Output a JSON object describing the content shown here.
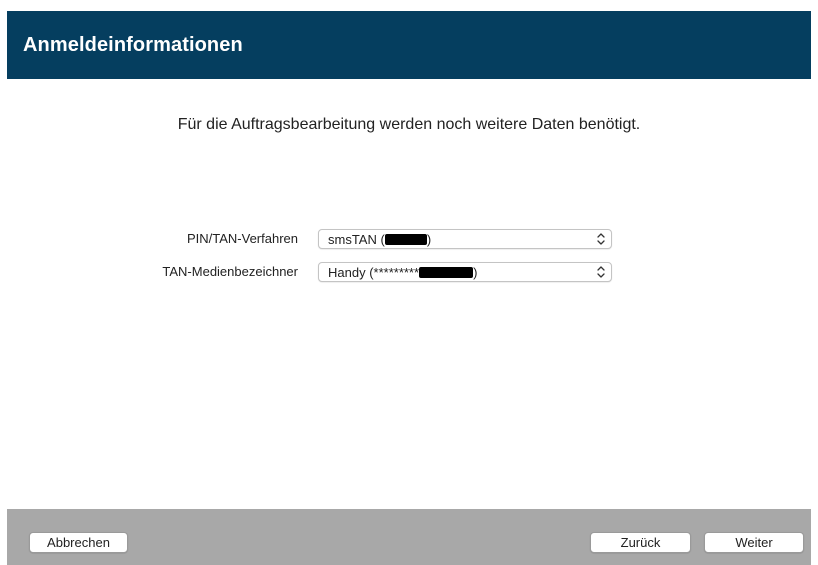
{
  "header": {
    "title": "Anmeldeinformationen"
  },
  "intro": {
    "text": "Für die Auftragsbearbeitung werden noch weitere Daten benötigt."
  },
  "form": {
    "pin_tan": {
      "label": "PIN/TAN-Verfahren",
      "value_prefix": "smsTAN (",
      "value_suffix": ")"
    },
    "tan_medium": {
      "label": "TAN-Medienbezeichner",
      "value_prefix": "Handy (*********",
      "value_suffix": ")"
    }
  },
  "footer": {
    "cancel_label": "Abbrechen",
    "back_label": "Zurück",
    "next_label": "Weiter"
  },
  "colors": {
    "header_bg": "#053e5f",
    "footer_bg": "#a8a8a8",
    "redaction": "#000000"
  },
  "icons": {
    "select_chevron": "chevron-up-down-icon"
  }
}
